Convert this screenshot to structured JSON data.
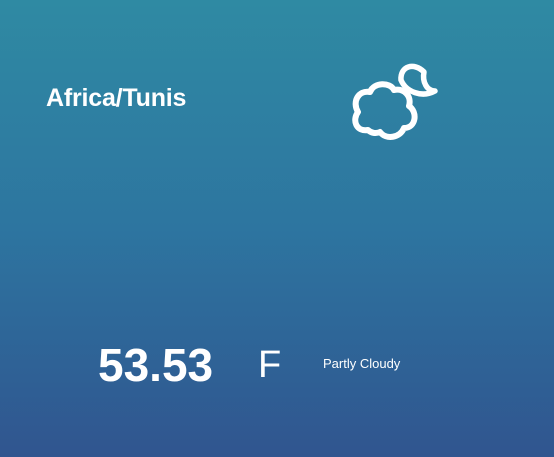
{
  "weather": {
    "timezone": "Africa/Tunis",
    "temperature": "53.53",
    "unit": "F",
    "condition": "Partly Cloudy",
    "icon": "cloud-moon-icon"
  },
  "theme": {
    "gradient_top": "#2f8aa3",
    "gradient_bottom": "#30558f",
    "text": "#ffffff"
  }
}
